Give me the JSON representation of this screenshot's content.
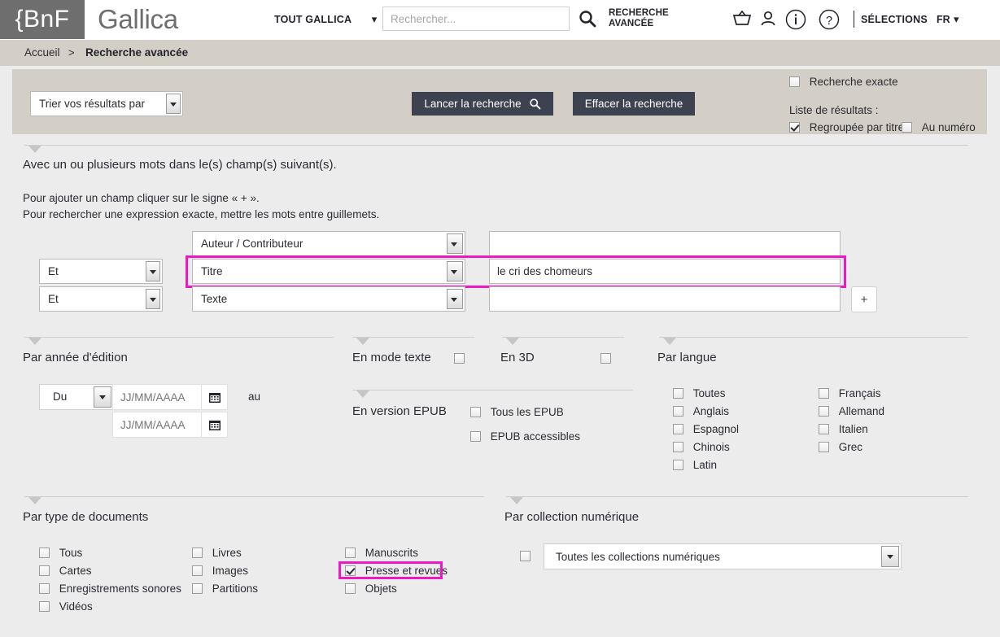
{
  "header": {
    "logo": "{BnF",
    "site_title": "Gallica",
    "scope_label": "TOUT GALLICA",
    "search_placeholder": "Rechercher...",
    "search_value": "",
    "advanced_search": "RECHERCHE AVANCÉE",
    "selections": "SÉLECTIONS",
    "language": "FR",
    "icons": [
      "basket-icon",
      "user-icon",
      "info-icon",
      "help-icon"
    ]
  },
  "breadcrumb": {
    "home": "Accueil",
    "separator": ">",
    "current": "Recherche avancée"
  },
  "toolbar": {
    "sort_label": "Trier vos résultats par",
    "launch_label": "Lancer la recherche",
    "clear_label": "Effacer la recherche",
    "exact_search": {
      "label": "Recherche exacte",
      "checked": false
    },
    "results_list_label": "Liste de résultats :",
    "grouped": {
      "label": "Regroupée par titre",
      "checked": true
    },
    "numbered": {
      "label": "Au numéro",
      "checked": false
    }
  },
  "criteria": {
    "section_title": "Avec un ou plusieurs mots dans le(s) champ(s) suivant(s).",
    "hint1": "Pour ajouter un champ cliquer sur le signe « + ».",
    "hint2": "Pour rechercher une expression exacte, mettre les mots entre guillemets.",
    "add_field_label": "+",
    "rows": [
      {
        "operator": null,
        "field": "Auteur / Contributeur",
        "value": "",
        "highlighted": false
      },
      {
        "operator": "Et",
        "field": "Titre",
        "value": "le cri des chomeurs",
        "highlighted": true
      },
      {
        "operator": "Et",
        "field": "Texte",
        "value": "",
        "highlighted": false
      }
    ]
  },
  "year_section": {
    "title": "Par année d'édition",
    "from_label": "Du",
    "date_placeholder": "JJ/MM/AAAA",
    "date_from_value": "",
    "date_to_value": "",
    "au_label": "au"
  },
  "text_mode": {
    "title": "En mode texte",
    "checked": false
  },
  "three_d": {
    "title": "En 3D",
    "checked": false
  },
  "epub": {
    "title": "En version EPUB",
    "options": [
      {
        "label": "Tous les EPUB",
        "checked": false
      },
      {
        "label": "EPUB accessibles",
        "checked": false
      }
    ]
  },
  "language_section": {
    "title": "Par langue",
    "col1": [
      {
        "label": "Toutes",
        "checked": false
      },
      {
        "label": "Anglais",
        "checked": false
      },
      {
        "label": "Espagnol",
        "checked": false
      },
      {
        "label": "Chinois",
        "checked": false
      },
      {
        "label": "Latin",
        "checked": false
      }
    ],
    "col2": [
      {
        "label": "Français",
        "checked": false
      },
      {
        "label": "Allemand",
        "checked": false
      },
      {
        "label": "Italien",
        "checked": false
      },
      {
        "label": "Grec",
        "checked": false
      }
    ]
  },
  "doctype_section": {
    "title": "Par type de documents",
    "col1": [
      {
        "label": "Tous",
        "checked": false
      },
      {
        "label": "Cartes",
        "checked": false
      },
      {
        "label": "Enregistrements sonores",
        "checked": false
      },
      {
        "label": "Vidéos",
        "checked": false
      }
    ],
    "col2": [
      {
        "label": "Livres",
        "checked": false
      },
      {
        "label": "Images",
        "checked": false
      },
      {
        "label": "Partitions",
        "checked": false
      }
    ],
    "col3": [
      {
        "label": "Manuscrits",
        "checked": false
      },
      {
        "label": "Presse et revues",
        "checked": true,
        "highlighted": true
      },
      {
        "label": "Objets",
        "checked": false
      }
    ]
  },
  "collection_section": {
    "title": "Par collection numérique",
    "checkbox_checked": false,
    "selected": "Toutes les collections numériques"
  },
  "colors": {
    "accent_magenta": "#ef19c4",
    "dark_button": "#3c4250",
    "band_beige": "#d4cfc6",
    "page_bg": "#ececec",
    "logo_grey": "#6e6e6e"
  }
}
